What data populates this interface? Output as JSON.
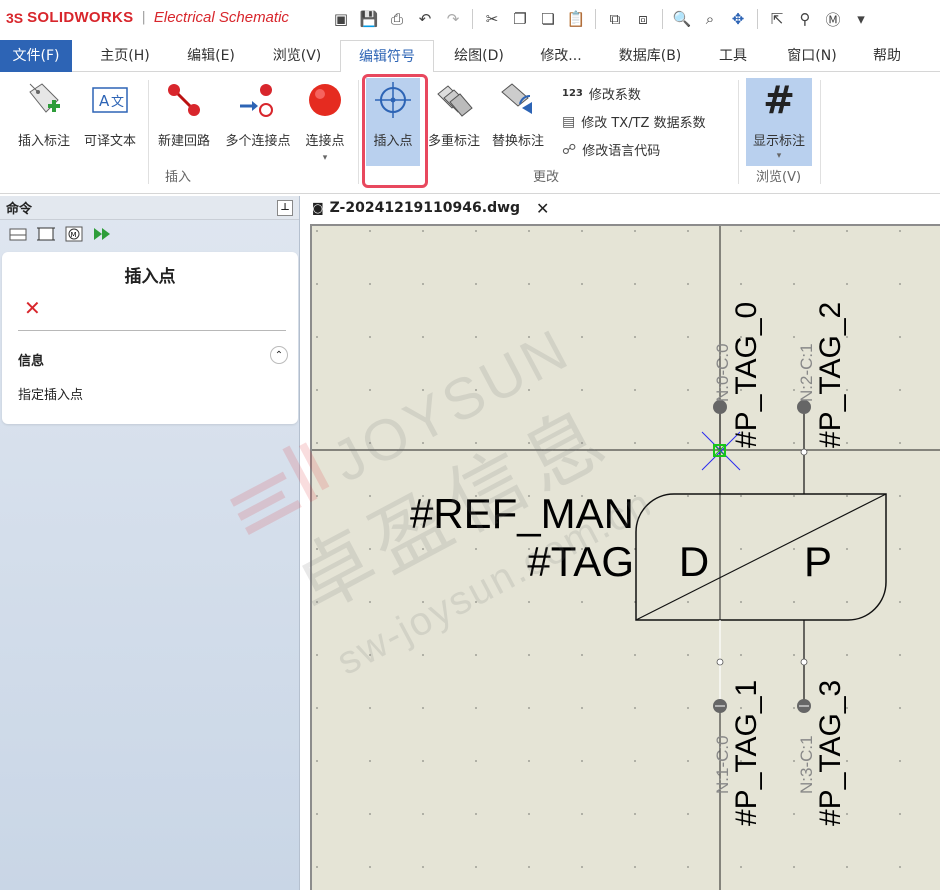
{
  "app": {
    "brand_ds": "3S",
    "brand_name": "SOLIDWORKS",
    "brand_sep": "|",
    "brand_product": "Electrical Schematic"
  },
  "menu": {
    "tabs": [
      "文件(F)",
      "主页(H)",
      "编辑(E)",
      "浏览(V)",
      "编辑符号",
      "绘图(D)",
      "修改...",
      "数据库(B)",
      "工具",
      "窗口(N)",
      "帮助"
    ],
    "active": "编辑符号"
  },
  "ribbon": {
    "insert_tag": "插入标注",
    "translatable_text": "可译文本",
    "new_circuit": "新建回路",
    "multi_connection": "多个连接点",
    "connection_point": "连接点",
    "insert_point": "插入点",
    "multi_tag": "多重标注",
    "replace_tag": "替换标注",
    "modify_coeff_icon": "123",
    "modify_coeff": "修改系数",
    "modify_txtz": "修改 TX/TZ 数据系数",
    "modify_lang": "修改语言代码",
    "show_tag": "显示标注",
    "group_insert": "插入",
    "group_modify": "更改",
    "group_browse": "浏览(V)"
  },
  "panel": {
    "header": "命令",
    "command_title": "插入点",
    "info_label": "信息",
    "hint": "指定插入点"
  },
  "document": {
    "tab_name": "Z-20241219110946.dwg"
  },
  "drawing": {
    "ref_man": "#REF_MAN",
    "tag": "#TAG",
    "left_letter": "D",
    "right_letter": "P",
    "pin_top_left": "#P_TAG_0",
    "pin_top_right": "#P_TAG_2",
    "pin_bottom_left": "#P_TAG_1",
    "pin_bottom_right": "#P_TAG_3",
    "node_top_left": "N:0-C:0",
    "node_top_right": "N:2-C:1",
    "node_bottom_left": "N:1-C:0",
    "node_bottom_right": "N:3-C:1"
  },
  "watermark": {
    "brand": "JOYSUN",
    "cn": "卓盈信息",
    "url": "sw-joysun.com.cn"
  },
  "colors": {
    "file_tab": "#2d64b5",
    "active_tab_text": "#2d64b5",
    "highlight_box": "#e8485e",
    "canvas_bg": "#e5e4d6",
    "brand_red": "#d8262c"
  }
}
